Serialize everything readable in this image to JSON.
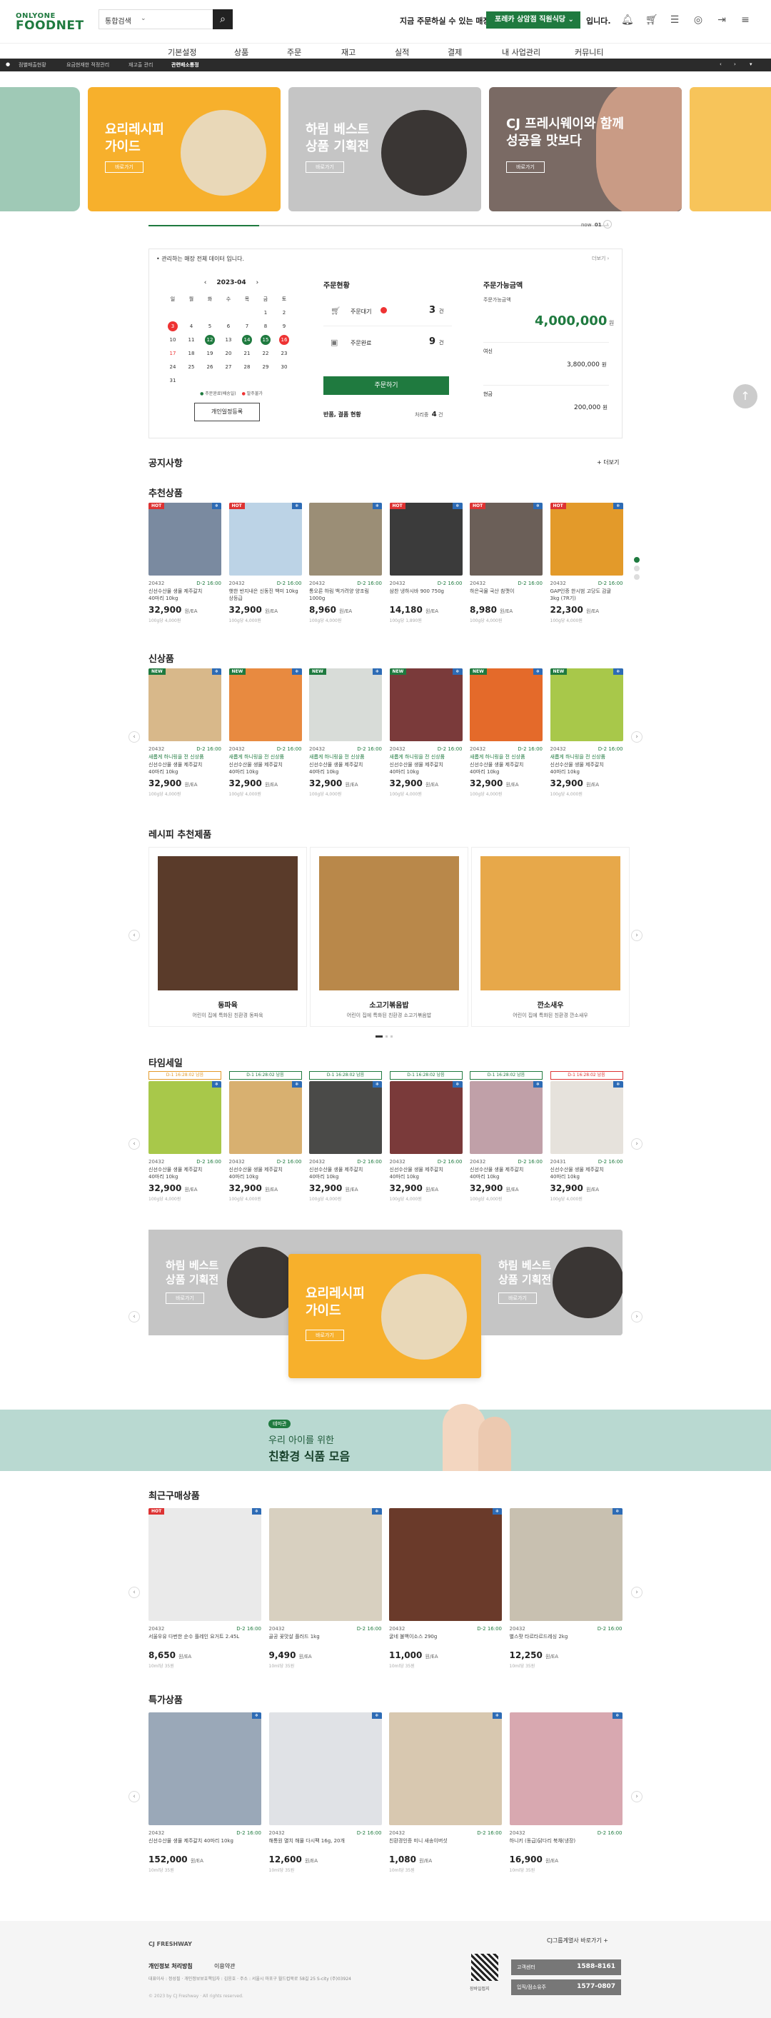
{
  "header": {
    "logo_top": "ONLYONE",
    "logo_main": "FOODNET",
    "search_select": "통합검색",
    "message_prefix": "지금 주문하실 수 있는 매장은",
    "store": "포레카 상암점 직원식당",
    "message_suffix": "입니다."
  },
  "nav": [
    "기본설정",
    "상품",
    "주문",
    "재고",
    "실적",
    "결제",
    "내 사업관리",
    "커뮤니티"
  ],
  "tabs": [
    "점별매출현황",
    "요금현재한 적정관리",
    "재고출 관리",
    "관련배소통정"
  ],
  "hero": [
    {
      "title": "요리레시피\n가이드",
      "button": "바로가기",
      "color": "#f7b02c"
    },
    {
      "title": "하림 베스트\n상품 기획전",
      "button": "바로가기",
      "color": "#c5c5c5"
    },
    {
      "title": "CJ 프레시웨이와 함께\n성공을 맛보다",
      "button": "바로가기",
      "color": "#7a6a64"
    }
  ],
  "hero_pager": {
    "current": "now",
    "page": "01"
  },
  "dashboard": {
    "notice": "관리하는 매장 전체 데이터 입니다.",
    "more": "더보기",
    "calendar": {
      "month": "2023-04",
      "weekdays": [
        "일",
        "월",
        "화",
        "수",
        "목",
        "금",
        "토"
      ],
      "weeks": [
        [
          "",
          "",
          "",
          "",
          "",
          "1",
          "2"
        ],
        [
          "3",
          "4",
          "5",
          "6",
          "7",
          "8",
          "9"
        ],
        [
          "10",
          "11",
          "12",
          "13",
          "14",
          "15",
          "16"
        ],
        [
          "17",
          "18",
          "19",
          "20",
          "21",
          "22",
          "23"
        ],
        [
          "24",
          "25",
          "26",
          "27",
          "28",
          "29",
          "30"
        ],
        [
          "31",
          "",
          "",
          "",
          "",
          "",
          ""
        ]
      ],
      "legend_green": "주문완료(배송일)",
      "legend_red": "발주불가",
      "button": "개인일정등록"
    },
    "order": {
      "title": "주문현황",
      "waiting_label": "주문대기",
      "waiting_value": "3",
      "waiting_unit": "건",
      "done_label": "주문완료",
      "done_value": "9",
      "done_unit": "건",
      "button": "주문하기",
      "return_label": "반품, 결품 현황",
      "return_label2": "처리중",
      "return_value": "4",
      "return_unit": "건"
    },
    "available": {
      "title": "주문가능금액",
      "sub": "주문가능금액",
      "amount": "4,000,000",
      "unit": "원",
      "row1_label": "여신",
      "row1_value": "3,800,000",
      "row2_label": "현금",
      "row2_value": "200,000"
    }
  },
  "notice": {
    "title": "공지사항",
    "more": "+ 더보기"
  },
  "sections": {
    "recommended": "추천상품",
    "new": "신상품",
    "recipe": "레시피 추천제품",
    "timesale": "타임세일",
    "recent": "최근구매상품",
    "special": "특가상품"
  },
  "recommended": [
    {
      "badge": "HOT",
      "color": "#7a8aa0",
      "code": "20432",
      "dday": "D-2 16:00",
      "name": "신선수산물 생물 제주갈치\n40마리 10kg",
      "price": "32,900",
      "unit": "원/EA",
      "unitprice": "100g당 4,000원"
    },
    {
      "badge": "HOT",
      "color": "#bcd3e6",
      "code": "20432",
      "dday": "D-2 16:00",
      "name": "햇한 반지내은 신동진 백미 10kg\n상등급",
      "price": "32,900",
      "unit": "원/EA",
      "unitprice": "100g당 4,000원"
    },
    {
      "badge": "",
      "color": "#9b8e76",
      "code": "20432",
      "dday": "D-2 16:00",
      "name": "통오른 하림 백가려양 양조림\n1000g",
      "price": "8,960",
      "unit": "원/EA",
      "unitprice": "100g당 4,000원"
    },
    {
      "badge": "HOT",
      "color": "#3b3b3b",
      "code": "20432",
      "dday": "D-2 16:00",
      "name": "삼찬 냉하시바 900 750g",
      "price": "14,180",
      "unit": "원/EA",
      "unitprice": "100g당 1,890원"
    },
    {
      "badge": "HOT",
      "color": "#6b5f58",
      "code": "20432",
      "dday": "D-2 16:00",
      "name": "하은국물 국산 참깻이",
      "price": "8,980",
      "unit": "원/EA",
      "unitprice": "100g당 4,000원"
    },
    {
      "badge": "HOT",
      "color": "#e39a2a",
      "code": "20432",
      "dday": "D-2 16:00",
      "name": "GAP인증 한시범 고당도 감귤\n3kg (7R기)",
      "price": "22,300",
      "unit": "원/EA",
      "unitprice": "100g당 4,000원"
    }
  ],
  "newitems": [
    {
      "badge": "NEW",
      "color": "#d8b88a",
      "code": "20432",
      "dday": "D-2 16:00",
      "promo": "새롭게 하니링을 전 신상품",
      "name": "신선수산물 생물 제주갈치\n40마리 10kg",
      "price": "32,900",
      "unit": "원/EA",
      "unitprice": "100g당 4,000원"
    },
    {
      "badge": "NEW",
      "color": "#e88a40",
      "code": "20432",
      "dday": "D-2 16:00",
      "promo": "새롭게 하니링을 전 신상품",
      "name": "신선수산물 생물 제주갈치\n40마리 10kg",
      "price": "32,900",
      "unit": "원/EA",
      "unitprice": "100g당 4,000원"
    },
    {
      "badge": "NEW",
      "color": "#d8dcd8",
      "code": "20432",
      "dday": "D-2 16:00",
      "promo": "새롭게 하니링을 전 신상품",
      "name": "신선수산물 생물 제주갈치\n40마리 10kg",
      "price": "32,900",
      "unit": "원/EA",
      "unitprice": "100g당 4,000원"
    },
    {
      "badge": "NEW",
      "color": "#7a3a3a",
      "code": "20432",
      "dday": "D-2 16:00",
      "promo": "새롭게 하니링을 전 신상품",
      "name": "신선수산물 생물 제주갈치\n40마리 10kg",
      "price": "32,900",
      "unit": "원/EA",
      "unitprice": "100g당 4,000원"
    },
    {
      "badge": "NEW",
      "color": "#e46a2a",
      "code": "20432",
      "dday": "D-2 16:00",
      "promo": "새롭게 하니링을 전 신상품",
      "name": "신선수산물 생물 제주갈치\n40마리 10kg",
      "price": "32,900",
      "unit": "원/EA",
      "unitprice": "100g당 4,000원"
    },
    {
      "badge": "NEW",
      "color": "#a8c84a",
      "code": "20432",
      "dday": "D-2 16:00",
      "promo": "새롭게 하니링을 전 신상품",
      "name": "신선수산물 생물 제주갈치\n40마리 10kg",
      "price": "32,900",
      "unit": "원/EA",
      "unitprice": "100g당 4,000원"
    }
  ],
  "recipes": [
    {
      "title": "동파육",
      "desc": "어린이 집에 특화된 친환경 동파육",
      "color": "#5a3b2a"
    },
    {
      "title": "소고기볶음밥",
      "desc": "어린이 집에 특화된 친환경 소고기볶음밥",
      "color": "#b9884a"
    },
    {
      "title": "깐소새우",
      "desc": "어린이 집에 특화된 친환경 깐소새우",
      "color": "#e7a84a"
    }
  ],
  "timesale": [
    {
      "timer": "D-1 16:28:02 남음",
      "tcolor": "#e39a2a",
      "color": "#a8c84a",
      "code": "20432",
      "dday": "D-2 16:00",
      "name": "신선수산물 생물 제주갈치\n40마리 10kg",
      "price": "32,900",
      "unit": "원/EA",
      "unitprice": "100g당 4,000원"
    },
    {
      "timer": "D-1 16:28:02 남음",
      "tcolor": "#1f7a3f",
      "color": "#d8b070",
      "code": "20432",
      "dday": "D-2 16:00",
      "name": "신선수산물 생물 제주갈치\n40마리 10kg",
      "price": "32,900",
      "unit": "원/EA",
      "unitprice": "100g당 4,000원"
    },
    {
      "timer": "D-1 16:28:02 남음",
      "tcolor": "#1f7a3f",
      "color": "#4a4a48",
      "code": "20432",
      "dday": "D-2 16:00",
      "name": "신선수산물 생물 제주갈치\n40마리 10kg",
      "price": "32,900",
      "unit": "원/EA",
      "unitprice": "100g당 4,000원"
    },
    {
      "timer": "D-1 16:28:02 남음",
      "tcolor": "#1f7a3f",
      "color": "#7a3a3a",
      "code": "20432",
      "dday": "D-2 16:00",
      "name": "신선수산물 생물 제주갈치\n40마리 10kg",
      "price": "32,900",
      "unit": "원/EA",
      "unitprice": "100g당 4,000원"
    },
    {
      "timer": "D-1 16:28:02 남음",
      "tcolor": "#1f7a3f",
      "color": "#c0a0a8",
      "code": "20432",
      "dday": "D-2 16:00",
      "name": "신선수산물 생물 제주갈치\n40마리 10kg",
      "price": "32,900",
      "unit": "원/EA",
      "unitprice": "100g당 4,000원"
    },
    {
      "timer": "D-1 16:28:02 남음",
      "tcolor": "#d33",
      "color": "#e6e2dc",
      "code": "20431",
      "dday": "D-2 16:00",
      "name": "신선수산물 생물 제주갈치\n40마리 10kg",
      "price": "32,900",
      "unit": "원/EA",
      "unitprice": "100g당 4,000원"
    }
  ],
  "banner2": [
    {
      "title": "하림 베스트\n상품 기획전",
      "button": "바로가기",
      "color": "#c5c5c5"
    },
    {
      "title": "요리레시피\n가이드",
      "button": "바로가기",
      "color": "#f7b02c"
    },
    {
      "title": "하림 베스트\n상품 기획전",
      "button": "바로가기",
      "color": "#c5c5c5"
    }
  ],
  "kids_banner": {
    "tag": "테마관",
    "line1": "우리 아이를 위한",
    "line2": "친환경 식품 모음"
  },
  "recent": [
    {
      "badge": "HOT",
      "color": "#eaeaea",
      "code": "20432",
      "dday": "D-2 16:00",
      "name": "서울우유 다번한 순수 플레인 요거트 2.45L",
      "price": "8,650",
      "unit": "원/EA",
      "unitprice": "10ml당 35원"
    },
    {
      "badge": "",
      "color": "#d8d0c0",
      "code": "20432",
      "dday": "D-2 16:00",
      "name": "골공 꽃맛살 플러드 1kg",
      "price": "9,490",
      "unit": "원/EA",
      "unitprice": "10ml당 35원"
    },
    {
      "badge": "",
      "color": "#6a3a2a",
      "code": "20432",
      "dday": "D-2 16:00",
      "name": "굴네 불백이소스 290g",
      "price": "11,000",
      "unit": "원/EA",
      "unitprice": "10ml당 35원"
    },
    {
      "badge": "",
      "color": "#c8c0b0",
      "code": "20432",
      "dday": "D-2 16:00",
      "name": "별스팟 타르타르드레싱 2kg",
      "price": "12,250",
      "unit": "원/EA",
      "unitprice": "10ml당 35원"
    }
  ],
  "special": [
    {
      "badge": "",
      "color": "#9aa8b8",
      "code": "20432",
      "dday": "D-2 16:00",
      "name": "신선수산물 생물 제주갈치 40마리 10kg",
      "price": "152,000",
      "unit": "원/EA",
      "unitprice": "10ml당 35원"
    },
    {
      "badge": "",
      "color": "#e0e2e6",
      "code": "20432",
      "dday": "D-2 16:00",
      "name": "해통원 멸치 해물 다시팩 16g, 20개",
      "price": "12,600",
      "unit": "원/EA",
      "unitprice": "10ml당 35원"
    },
    {
      "badge": "",
      "color": "#d8c8b0",
      "code": "20432",
      "dday": "D-2 16:00",
      "name": "친환경인증 미니 새송이버섯",
      "price": "1,080",
      "unit": "원/EA",
      "unitprice": "10ml당 35원"
    },
    {
      "badge": "",
      "color": "#d8a8b0",
      "code": "20432",
      "dday": "D-2 16:00",
      "name": "하니키 (동급)닭다리 북채(냉장)",
      "price": "16,900",
      "unit": "원/EA",
      "unitprice": "10ml당 35원"
    }
  ],
  "footer": {
    "brand": "CJ FRESHWAY",
    "link1": "개인정보 처리방침",
    "link2": "이용약관",
    "address": "대표이사 : 정성필 · 개인정보보호책임자 : 김응호 · 주소 : 서울시 마포구 월드컵북로 58길 25 S-city (주)03924",
    "copy": "© 2023 by CJ Freshway · All rights reserved.",
    "qr_label": "장바일접지",
    "site_link": "CJ그룹계열사 바로가기 +",
    "center1_label": "고객센터",
    "center1_value": "1588-8161",
    "center2_label": "입직/점소유주",
    "center2_value": "1577-0807"
  }
}
